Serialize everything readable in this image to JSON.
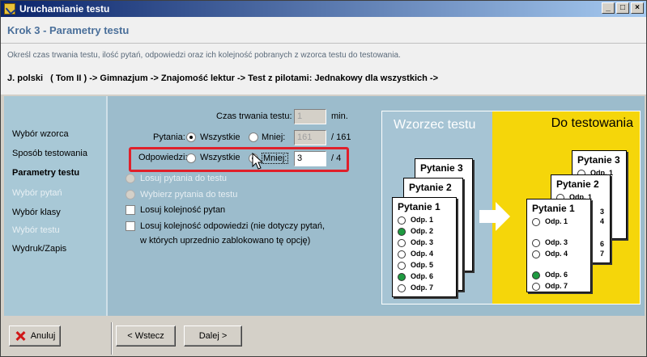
{
  "window": {
    "title": "Uruchamianie testu"
  },
  "header": {
    "step_title": "Krok 3 - Parametry testu",
    "description": "Określ czas trwania testu, ilość pytań, odpowiedzi oraz ich kolejność pobranych z wzorca testu do testowania.",
    "breadcrumb": "J. polski   ( Tom II ) -> Gimnazjum -> Znajomość lektur -> Test z pilotami: Jednakowy dla wszystkich ->"
  },
  "sidebar": {
    "items": [
      {
        "label": "Wybór wzorca",
        "state": "normal"
      },
      {
        "label": "Sposób testowania",
        "state": "normal"
      },
      {
        "label": "Parametry testu",
        "state": "active"
      },
      {
        "label": "Wybór pytań",
        "state": "disabled"
      },
      {
        "label": "Wybór klasy",
        "state": "normal"
      },
      {
        "label": "Wybór testu",
        "state": "disabled"
      },
      {
        "label": "Wydruk/Zapis",
        "state": "normal"
      }
    ]
  },
  "form": {
    "duration_label": "Czas trwania testu:",
    "duration_value": "1",
    "duration_unit": "min.",
    "questions_label": "Pytania:",
    "all_label": "Wszystkie",
    "less_label": "Mniej:",
    "questions_value": "161",
    "questions_total": "/ 161",
    "answers_label": "Odpowiedzi:",
    "answers_value": "3",
    "answers_total": "/ 4",
    "random_questions": "Losuj pytania do testu",
    "choose_questions": "Wybierz pytania do testu",
    "shuffle_questions": "Losuj kolejność pytan",
    "shuffle_answers_1": "Losuj kolejność odpowiedzi (nie dotyczy pytań,",
    "shuffle_answers_2": "w których uprzednio zablokowano tę opcję)"
  },
  "illustration": {
    "left_title": "Wzorzec testu",
    "right_title": "Do testowania",
    "q1": "Pytanie 1",
    "q2": "Pytanie 2",
    "q3": "Pytanie 3",
    "a1": "Odp. 1",
    "a2": "Odp. 2",
    "a3": "Odp. 3",
    "a4": "Odp. 4",
    "a5": "Odp. 5",
    "a6": "Odp. 6",
    "a7": "Odp. 7",
    "n3": "3",
    "n4": "4",
    "n6": "6",
    "n7": "7",
    "highlight_color": "#e0202a",
    "correct_color": "#1e9a40",
    "right_bg": "#f5d60a"
  },
  "buttons": {
    "cancel": "Anuluj",
    "back": "< Wstecz",
    "next": "Dalej >"
  }
}
